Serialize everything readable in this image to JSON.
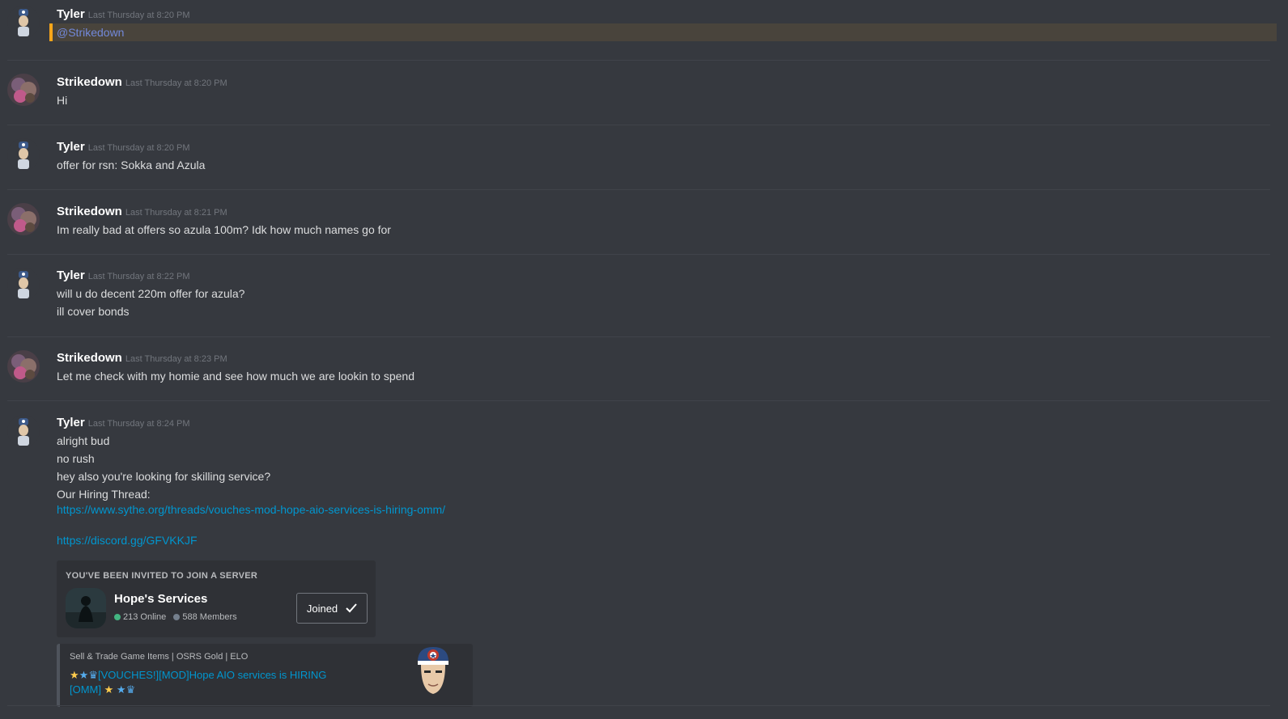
{
  "messages": [
    {
      "author": "Tyler",
      "timestamp": "Last Thursday at 8:20 PM",
      "mention": "@Strikedown"
    },
    {
      "author": "Strikedown",
      "timestamp": "Last Thursday at 8:20 PM",
      "lines": [
        "Hi"
      ]
    },
    {
      "author": "Tyler",
      "timestamp": "Last Thursday at 8:20 PM",
      "lines": [
        "offer for rsn: Sokka and Azula"
      ]
    },
    {
      "author": "Strikedown",
      "timestamp": "Last Thursday at 8:21 PM",
      "lines": [
        "Im really bad at offers so azula 100m? Idk how much names go for"
      ]
    },
    {
      "author": "Tyler",
      "timestamp": "Last Thursday at 8:22 PM",
      "lines": [
        "will u do decent 220m offer for azula?",
        "ill cover bonds"
      ]
    },
    {
      "author": "Strikedown",
      "timestamp": "Last Thursday at 8:23 PM",
      "lines": [
        "Let me check with my homie and see how much we are lookin to spend"
      ]
    },
    {
      "author": "Tyler",
      "timestamp": "Last Thursday at 8:24 PM",
      "lines": [
        "alright bud",
        "no rush",
        "hey also you're looking for skilling service?",
        "Our Hiring Thread:"
      ],
      "link1": "https://www.sythe.org/threads/vouches-mod-hope-aio-services-is-hiring-omm/",
      "link2": "https://discord.gg/GFVKKJF"
    }
  ],
  "invite": {
    "title": "YOU'VE BEEN INVITED TO JOIN A SERVER",
    "server_name": "Hope's Services",
    "online": "213 Online",
    "members": "588 Members",
    "button_label": "Joined",
    "online_color": "#43b581",
    "members_color": "#747f8d"
  },
  "embed": {
    "provider": "Sell & Trade Game Items | OSRS Gold | ELO",
    "title_line1": "[VOUCHES!][MOD]Hope AIO services is HIRING",
    "title_line2": "[OMM]"
  },
  "colors": {
    "background": "#36393f",
    "mention_highlight": "#faa61a",
    "link": "#0096cf"
  }
}
